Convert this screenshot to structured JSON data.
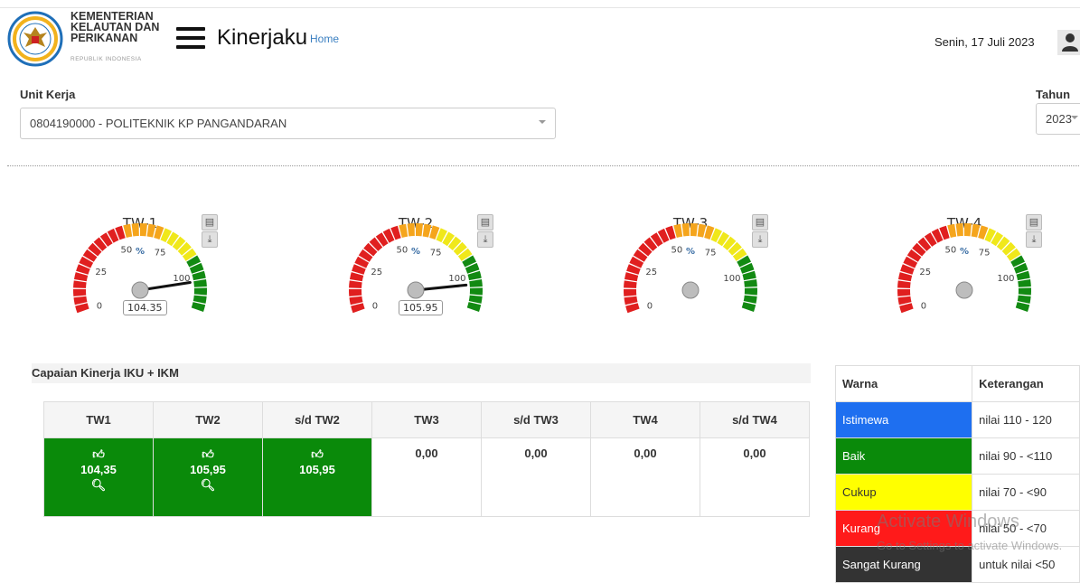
{
  "header": {
    "org_line1": "KEMENTERIAN",
    "org_line2": "KELAUTAN DAN",
    "org_line3": "PERIKANAN",
    "org_sub": "REPUBLIK INDONESIA",
    "app_title": "Kinerjaku",
    "home_link": "Home",
    "date": "Senin, 17 Juli 2023"
  },
  "filters": {
    "unit_label": "Unit Kerja",
    "unit_value": "0804190000 - POLITEKNIK KP PANGANDARAN",
    "year_label": "Tahun",
    "year_value": "2023"
  },
  "gauges": [
    {
      "title": "TW-1",
      "value": 104.35,
      "value_label": "104.35"
    },
    {
      "title": "TW-2",
      "value": 105.95,
      "value_label": "105.95"
    },
    {
      "title": "TW-3",
      "value": null,
      "value_label": ""
    },
    {
      "title": "TW-4",
      "value": null,
      "value_label": ""
    }
  ],
  "gauge_scale": {
    "min": 0,
    "max": 120,
    "ticks": [
      "0",
      "25",
      "50",
      "75",
      "100"
    ],
    "unit": "%"
  },
  "section_title": "Capaian Kinerja IKU + IKM",
  "table": {
    "headers": [
      "TW1",
      "TW2",
      "s/d TW2",
      "TW3",
      "s/d TW3",
      "TW4",
      "s/d TW4"
    ],
    "values": [
      "104,35",
      "105,95",
      "105,95",
      "0,00",
      "0,00",
      "0,00",
      "0,00"
    ]
  },
  "legend": {
    "headers": [
      "Warna",
      "Keterangan"
    ],
    "rows": [
      {
        "label": "Istimewa",
        "desc": "nilai 110 - 120",
        "color": "#1e6ff0"
      },
      {
        "label": "Baik",
        "desc": "nilai 90 - <110",
        "color": "#0a8a0a"
      },
      {
        "label": "Cukup",
        "desc": "nilai 70 - <90",
        "color": "#ffff00"
      },
      {
        "label": "Kurang",
        "desc": "nilai 50 - <70",
        "color": "#ff1a1a"
      },
      {
        "label": "Sangat Kurang",
        "desc": "untuk nilai <50",
        "color": "#333333"
      }
    ]
  },
  "watermark": {
    "line1": "Activate Windows",
    "line2": "Go to Settings to activate Windows."
  },
  "colors": {
    "red": "#e01f1f",
    "orange": "#f5a51c",
    "yellow": "#f0e81a",
    "green": "#128a12"
  }
}
